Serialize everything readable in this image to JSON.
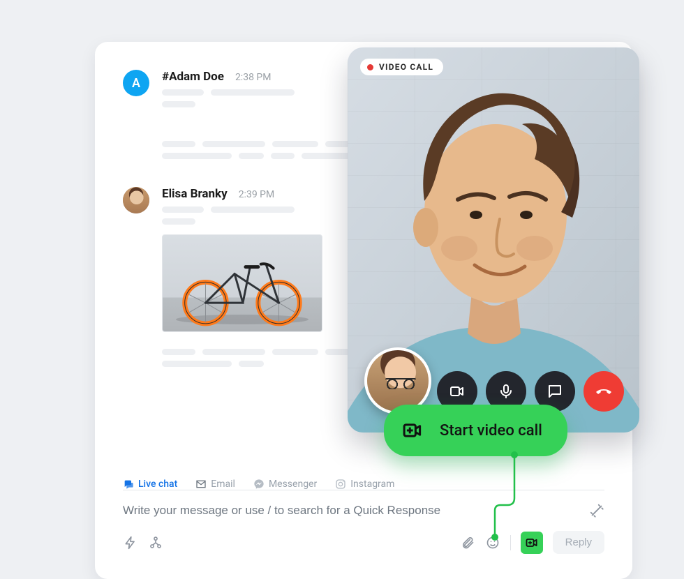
{
  "messages": [
    {
      "id": "adam",
      "avatar_letter": "A",
      "name": "#Adam Doe",
      "time": "2:38 PM"
    },
    {
      "id": "elisa",
      "avatar_letter": "",
      "name": "Elisa Branky",
      "time": "2:39 PM"
    }
  ],
  "tabs": [
    {
      "id": "livechat",
      "label": "Live chat"
    },
    {
      "id": "email",
      "label": "Email"
    },
    {
      "id": "messenger",
      "label": "Messenger"
    },
    {
      "id": "instagram",
      "label": "Instagram"
    }
  ],
  "composer": {
    "placeholder": "Write your message or use / to search for a Quick Response",
    "reply_label": "Reply"
  },
  "video_call": {
    "badge": "VIDEO CALL"
  },
  "start_button": {
    "label": "Start video call"
  }
}
